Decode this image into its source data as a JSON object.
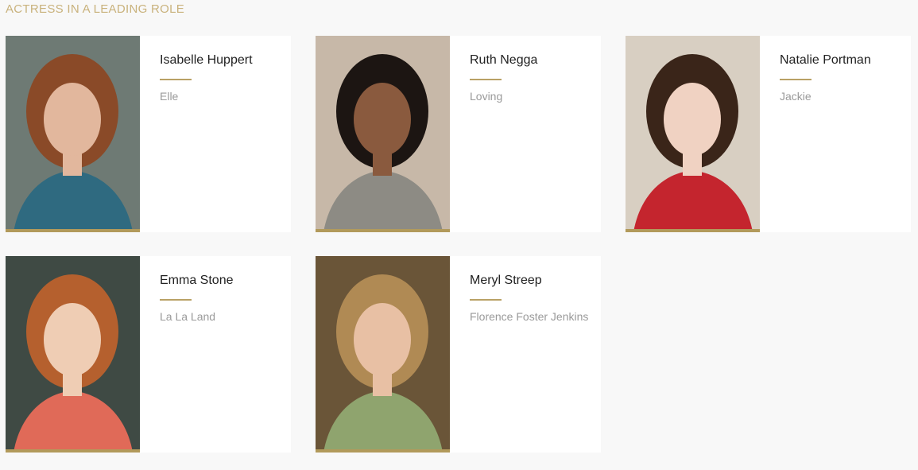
{
  "category": {
    "title": "ACTRESS IN A LEADING ROLE"
  },
  "nominees": [
    {
      "name": "Isabelle Huppert",
      "film": "Elle",
      "photo_icon": "portrait-photo",
      "palette": {
        "bg": "#6e7a74",
        "hair": "#8a4a28",
        "skin": "#e2b79d",
        "cloth": "#2f6a80"
      }
    },
    {
      "name": "Ruth Negga",
      "film": "Loving",
      "photo_icon": "portrait-photo",
      "palette": {
        "bg": "#c7b8a8",
        "hair": "#1c1512",
        "skin": "#8a5a3e",
        "cloth": "#8d8b84"
      }
    },
    {
      "name": "Natalie Portman",
      "film": "Jackie",
      "photo_icon": "portrait-photo",
      "palette": {
        "bg": "#d8cfc2",
        "hair": "#3a2519",
        "skin": "#f0d2c2",
        "cloth": "#c4252e"
      }
    },
    {
      "name": "Emma Stone",
      "film": "La La Land",
      "photo_icon": "portrait-photo",
      "palette": {
        "bg": "#3f4a44",
        "hair": "#b5602e",
        "skin": "#efcdb4",
        "cloth": "#e06a58"
      }
    },
    {
      "name": "Meryl Streep",
      "film": "Florence Foster Jenkins",
      "photo_icon": "portrait-photo",
      "palette": {
        "bg": "#6a5538",
        "hair": "#b08a54",
        "skin": "#e8c0a4",
        "cloth": "#8fa46e"
      }
    }
  ]
}
